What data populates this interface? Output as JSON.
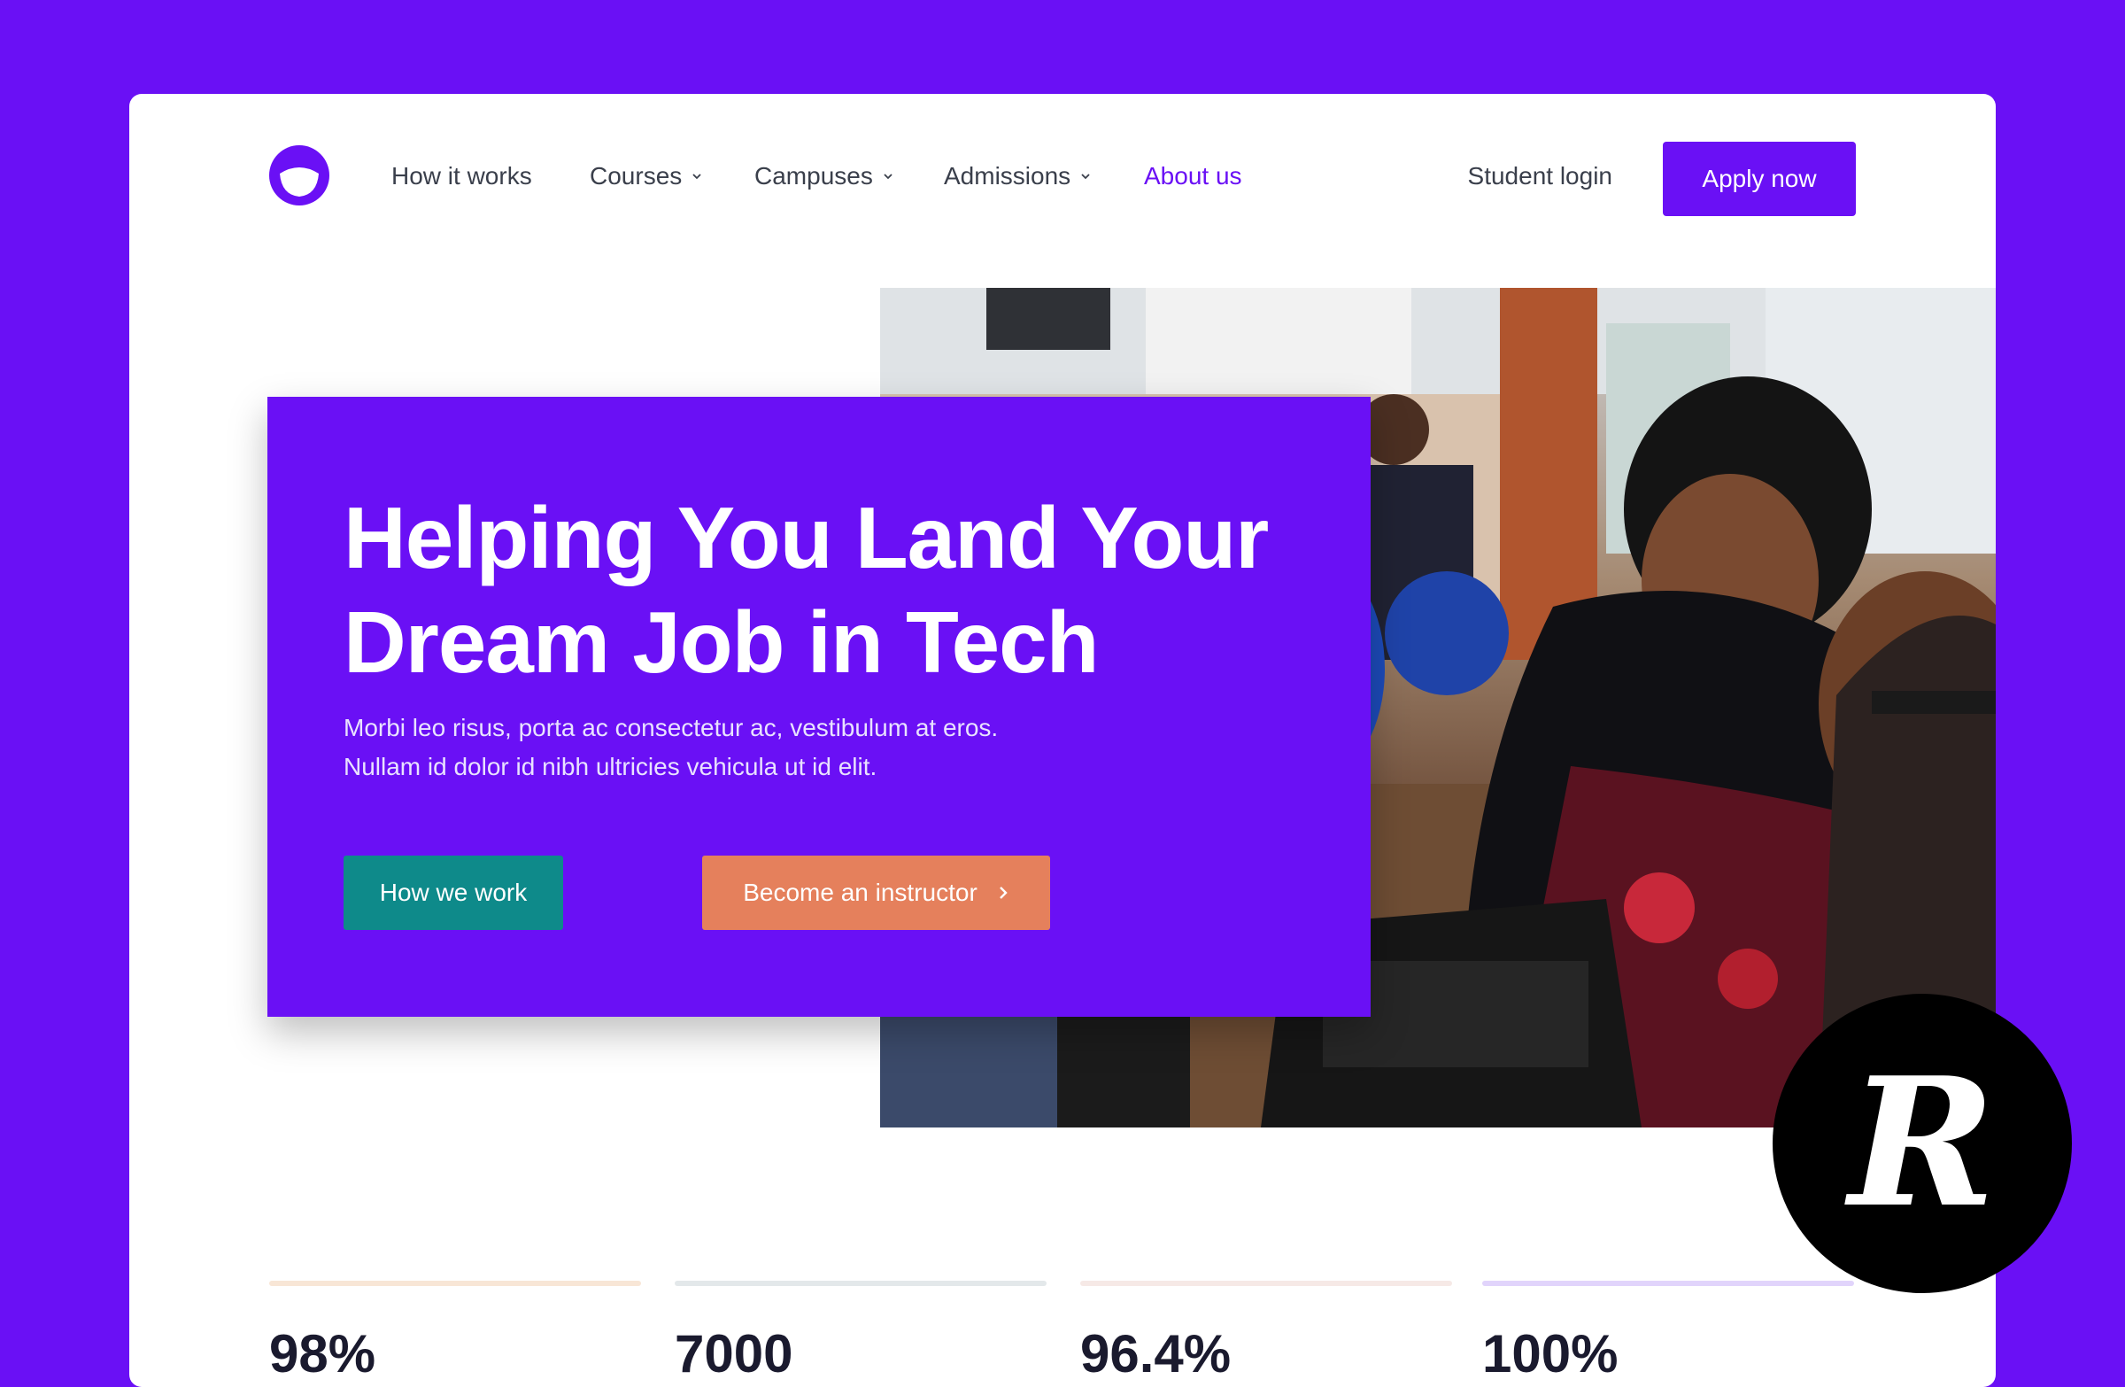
{
  "nav": {
    "items": [
      {
        "label": "How it works",
        "has_dropdown": false,
        "active": false
      },
      {
        "label": "Courses",
        "has_dropdown": true,
        "active": false
      },
      {
        "label": "Campuses",
        "has_dropdown": true,
        "active": false
      },
      {
        "label": "Admissions",
        "has_dropdown": true,
        "active": false
      },
      {
        "label": "About us",
        "has_dropdown": false,
        "active": true
      }
    ],
    "login_label": "Student login",
    "apply_label": "Apply now"
  },
  "hero": {
    "headline_line1": "Helping You Land Your",
    "headline_line2": "Dream Job in Tech",
    "subtext": "Morbi leo risus, porta ac consectetur ac, vestibulum at eros. Nullam id dolor id nibh ultricies vehicula ut id elit.",
    "primary_label": "How we work",
    "secondary_label": "Become an instructor"
  },
  "stats": [
    {
      "value": "98%",
      "color": "#f8e6d6"
    },
    {
      "value": "7000",
      "color": "#e3e8ea"
    },
    {
      "value": "96.4%",
      "color": "#f6e9e6"
    },
    {
      "value": "100%",
      "color": "#e1d4fb"
    }
  ],
  "badge": {
    "letter": "R"
  },
  "colors": {
    "brand": "#6a10f5",
    "teal": "#0e8a8a",
    "coral": "#e5805c",
    "nav_text": "#3a3f4b"
  }
}
